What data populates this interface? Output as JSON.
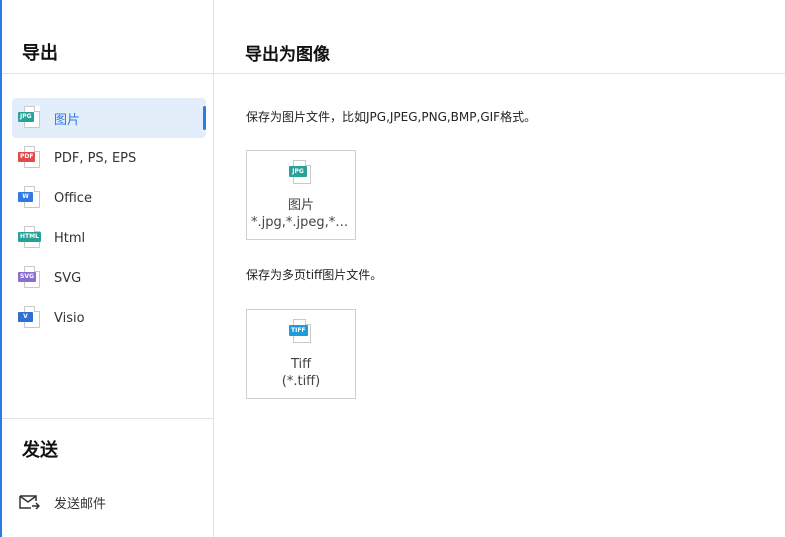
{
  "sidebar": {
    "export_heading": "导出",
    "send_heading": "发送",
    "items": [
      {
        "label": "图片",
        "tag": "JPG",
        "tag_color": "#2aa198",
        "active": true
      },
      {
        "label": "PDF, PS, EPS",
        "tag": "PDF",
        "tag_color": "#e24b4b",
        "active": false
      },
      {
        "label": "Office",
        "tag": "W",
        "tag_color": "#2f7be6",
        "active": false
      },
      {
        "label": "Html",
        "tag": "HTML",
        "tag_color": "#2aa198",
        "active": false
      },
      {
        "label": "SVG",
        "tag": "SVG",
        "tag_color": "#8a6fd1",
        "active": false
      },
      {
        "label": "Visio",
        "tag": "V",
        "tag_color": "#2f6fd6",
        "active": false
      }
    ],
    "send_items": [
      {
        "label": "发送邮件",
        "icon": "mail-send-icon"
      }
    ]
  },
  "main": {
    "title": "导出为图像",
    "sections": [
      {
        "description": "保存为图片文件，比如JPG,JPEG,PNG,BMP,GIF格式。",
        "card": {
          "tag": "JPG",
          "tag_color": "#2aa198",
          "name": "图片",
          "ext": "*.jpg,*.jpeg,*.p..."
        }
      },
      {
        "description": "保存为多页tiff图片文件。",
        "card": {
          "tag": "TIFF",
          "tag_color": "#1f9bd7",
          "name": "Tiff",
          "ext": "(*.tiff)"
        }
      }
    ]
  },
  "colors": {
    "accent": "#2a7be4",
    "active_bg": "#e4eefb"
  }
}
